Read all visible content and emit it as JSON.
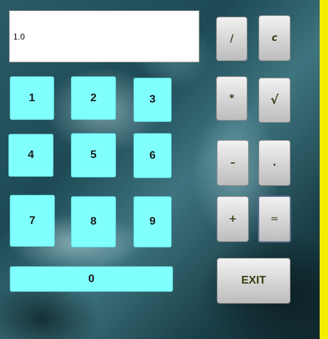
{
  "display": {
    "value": "1.0"
  },
  "keys": {
    "k1": "1",
    "k2": "2",
    "k3": "3",
    "k4": "4",
    "k5": "5",
    "k6": "6",
    "k7": "7",
    "k8": "8",
    "k9": "9",
    "k0": "0"
  },
  "ops": {
    "divide": "/",
    "clear": "c",
    "multiply": "*",
    "sqrt": "√",
    "minus": "–",
    "dot": ".",
    "plus": "+",
    "equals": "=",
    "exit": "EXIT"
  },
  "colors": {
    "number_key": "#80ffff",
    "side_stripe": "#f4ee00",
    "display_bg": "#ffffff"
  }
}
